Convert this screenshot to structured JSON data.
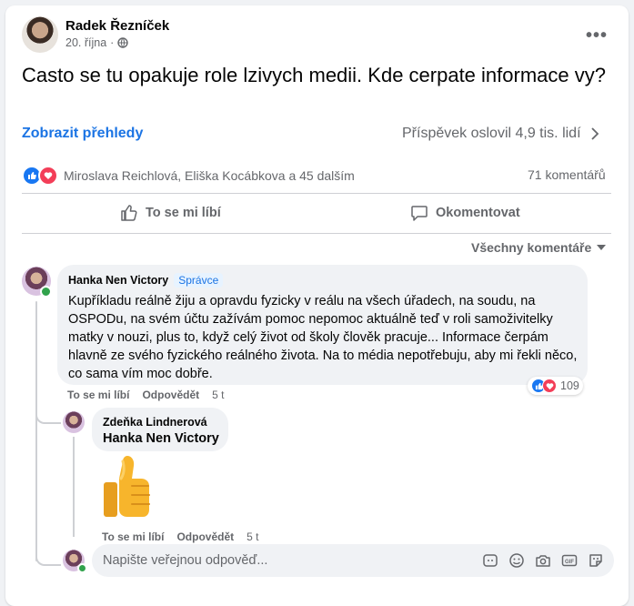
{
  "post": {
    "author": "Radek Řezníček",
    "date": "20. října",
    "separator": "·",
    "privacy_icon": "globe-icon",
    "text": "Casto se tu opakuje role lzivych medii. Kde cerpate informace vy?",
    "insights_link": "Zobrazit přehledy",
    "reach": "Příspěvek oslovil 4,9 tis. lidí",
    "reactors": "Miroslava Reichlová, Eliška Kocábkova a 45 dalším",
    "comments_count": "71 komentářů"
  },
  "actions": {
    "like": "To se mi líbí",
    "comment": "Okomentovat"
  },
  "filter": "Všechny komentáře",
  "comments": [
    {
      "author": "Hanka Nen Victory",
      "badge": "Správce",
      "text": "Kupříkladu reálně žiju a opravdu fyzicky v reálu na všech úřadech, na soudu, na OSPODu, na svém účtu zažívám pomoc nepomoc aktuálně teď v roli samoživitelky matky v nouzi, plus to, když celý život od školy člověk pracuje... Informace čerpám hlavně ze svého fyzického reálného života. Na to média nepotřebuju, aby mi řekli něco, co sama vím moc dobře.",
      "like": "To se mi líbí",
      "reply": "Odpovědět",
      "time": "5 t",
      "reactions": "109"
    },
    {
      "author": "Zdeňka Lindnerová",
      "mention": "Hanka Nen Victory",
      "sticker": "thumbs-up",
      "like": "To se mi líbí",
      "reply": "Odpovědět",
      "time": "5 t"
    }
  ],
  "reply_input": {
    "placeholder": "Napište veřejnou odpověď..."
  },
  "colors": {
    "accent": "#1b74e4",
    "like": "#1877f2",
    "love": "#f33e58",
    "online": "#31a24c"
  }
}
